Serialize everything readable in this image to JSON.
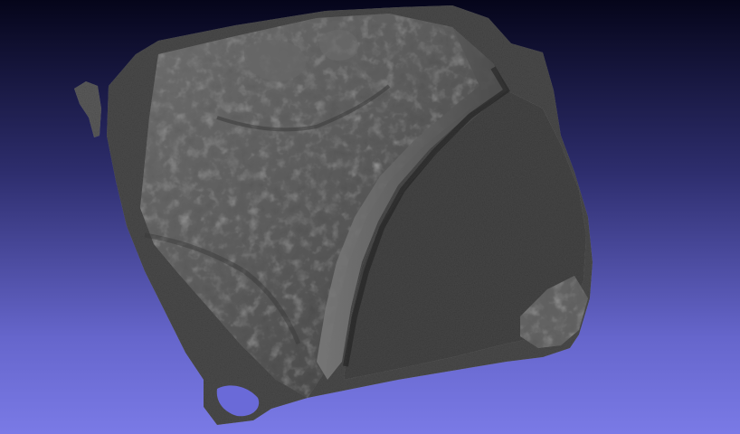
{
  "viewer": {
    "background_top": "#05051a",
    "background_bottom": "#7a7ae6",
    "mesh_color": "#555555",
    "mesh_shadow": "#1e1e1e",
    "mesh_highlight": "#7a7a7a",
    "render_mode": "shaded-mesh"
  }
}
